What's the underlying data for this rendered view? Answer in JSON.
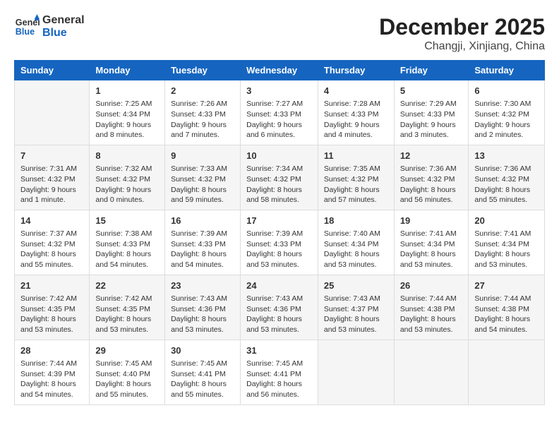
{
  "header": {
    "logo_line1": "General",
    "logo_line2": "Blue",
    "month_year": "December 2025",
    "location": "Changji, Xinjiang, China"
  },
  "weekdays": [
    "Sunday",
    "Monday",
    "Tuesday",
    "Wednesday",
    "Thursday",
    "Friday",
    "Saturday"
  ],
  "weeks": [
    [
      {
        "day": "",
        "info": ""
      },
      {
        "day": "1",
        "info": "Sunrise: 7:25 AM\nSunset: 4:34 PM\nDaylight: 9 hours\nand 8 minutes."
      },
      {
        "day": "2",
        "info": "Sunrise: 7:26 AM\nSunset: 4:33 PM\nDaylight: 9 hours\nand 7 minutes."
      },
      {
        "day": "3",
        "info": "Sunrise: 7:27 AM\nSunset: 4:33 PM\nDaylight: 9 hours\nand 6 minutes."
      },
      {
        "day": "4",
        "info": "Sunrise: 7:28 AM\nSunset: 4:33 PM\nDaylight: 9 hours\nand 4 minutes."
      },
      {
        "day": "5",
        "info": "Sunrise: 7:29 AM\nSunset: 4:33 PM\nDaylight: 9 hours\nand 3 minutes."
      },
      {
        "day": "6",
        "info": "Sunrise: 7:30 AM\nSunset: 4:32 PM\nDaylight: 9 hours\nand 2 minutes."
      }
    ],
    [
      {
        "day": "7",
        "info": "Sunrise: 7:31 AM\nSunset: 4:32 PM\nDaylight: 9 hours\nand 1 minute."
      },
      {
        "day": "8",
        "info": "Sunrise: 7:32 AM\nSunset: 4:32 PM\nDaylight: 9 hours\nand 0 minutes."
      },
      {
        "day": "9",
        "info": "Sunrise: 7:33 AM\nSunset: 4:32 PM\nDaylight: 8 hours\nand 59 minutes."
      },
      {
        "day": "10",
        "info": "Sunrise: 7:34 AM\nSunset: 4:32 PM\nDaylight: 8 hours\nand 58 minutes."
      },
      {
        "day": "11",
        "info": "Sunrise: 7:35 AM\nSunset: 4:32 PM\nDaylight: 8 hours\nand 57 minutes."
      },
      {
        "day": "12",
        "info": "Sunrise: 7:36 AM\nSunset: 4:32 PM\nDaylight: 8 hours\nand 56 minutes."
      },
      {
        "day": "13",
        "info": "Sunrise: 7:36 AM\nSunset: 4:32 PM\nDaylight: 8 hours\nand 55 minutes."
      }
    ],
    [
      {
        "day": "14",
        "info": "Sunrise: 7:37 AM\nSunset: 4:32 PM\nDaylight: 8 hours\nand 55 minutes."
      },
      {
        "day": "15",
        "info": "Sunrise: 7:38 AM\nSunset: 4:33 PM\nDaylight: 8 hours\nand 54 minutes."
      },
      {
        "day": "16",
        "info": "Sunrise: 7:39 AM\nSunset: 4:33 PM\nDaylight: 8 hours\nand 54 minutes."
      },
      {
        "day": "17",
        "info": "Sunrise: 7:39 AM\nSunset: 4:33 PM\nDaylight: 8 hours\nand 53 minutes."
      },
      {
        "day": "18",
        "info": "Sunrise: 7:40 AM\nSunset: 4:34 PM\nDaylight: 8 hours\nand 53 minutes."
      },
      {
        "day": "19",
        "info": "Sunrise: 7:41 AM\nSunset: 4:34 PM\nDaylight: 8 hours\nand 53 minutes."
      },
      {
        "day": "20",
        "info": "Sunrise: 7:41 AM\nSunset: 4:34 PM\nDaylight: 8 hours\nand 53 minutes."
      }
    ],
    [
      {
        "day": "21",
        "info": "Sunrise: 7:42 AM\nSunset: 4:35 PM\nDaylight: 8 hours\nand 53 minutes."
      },
      {
        "day": "22",
        "info": "Sunrise: 7:42 AM\nSunset: 4:35 PM\nDaylight: 8 hours\nand 53 minutes."
      },
      {
        "day": "23",
        "info": "Sunrise: 7:43 AM\nSunset: 4:36 PM\nDaylight: 8 hours\nand 53 minutes."
      },
      {
        "day": "24",
        "info": "Sunrise: 7:43 AM\nSunset: 4:36 PM\nDaylight: 8 hours\nand 53 minutes."
      },
      {
        "day": "25",
        "info": "Sunrise: 7:43 AM\nSunset: 4:37 PM\nDaylight: 8 hours\nand 53 minutes."
      },
      {
        "day": "26",
        "info": "Sunrise: 7:44 AM\nSunset: 4:38 PM\nDaylight: 8 hours\nand 53 minutes."
      },
      {
        "day": "27",
        "info": "Sunrise: 7:44 AM\nSunset: 4:38 PM\nDaylight: 8 hours\nand 54 minutes."
      }
    ],
    [
      {
        "day": "28",
        "info": "Sunrise: 7:44 AM\nSunset: 4:39 PM\nDaylight: 8 hours\nand 54 minutes."
      },
      {
        "day": "29",
        "info": "Sunrise: 7:45 AM\nSunset: 4:40 PM\nDaylight: 8 hours\nand 55 minutes."
      },
      {
        "day": "30",
        "info": "Sunrise: 7:45 AM\nSunset: 4:41 PM\nDaylight: 8 hours\nand 55 minutes."
      },
      {
        "day": "31",
        "info": "Sunrise: 7:45 AM\nSunset: 4:41 PM\nDaylight: 8 hours\nand 56 minutes."
      },
      {
        "day": "",
        "info": ""
      },
      {
        "day": "",
        "info": ""
      },
      {
        "day": "",
        "info": ""
      }
    ]
  ]
}
